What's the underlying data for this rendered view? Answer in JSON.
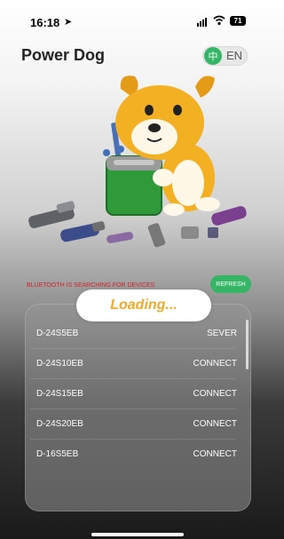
{
  "status_bar": {
    "time": "16:18",
    "battery": "71"
  },
  "header": {
    "title": "Power Dog",
    "lang_active": "中",
    "lang_other": "EN"
  },
  "connection": {
    "status_text": "BLUETOOTH IS SEARCHING FOR DEVICES",
    "refresh_label": "REFRESH"
  },
  "loading": {
    "label": "Loading..."
  },
  "devices": [
    {
      "name": "D-24S5EB",
      "action": "SEVER"
    },
    {
      "name": "D-24S10EB",
      "action": "CONNECT"
    },
    {
      "name": "D-24S15EB",
      "action": "CONNECT"
    },
    {
      "name": "D-24S20EB",
      "action": "CONNECT"
    },
    {
      "name": "D-16S5EB",
      "action": "CONNECT"
    }
  ],
  "colors": {
    "accent_green": "#35b565",
    "loading_orange": "#f0ab2a",
    "status_red": "#d32424"
  }
}
